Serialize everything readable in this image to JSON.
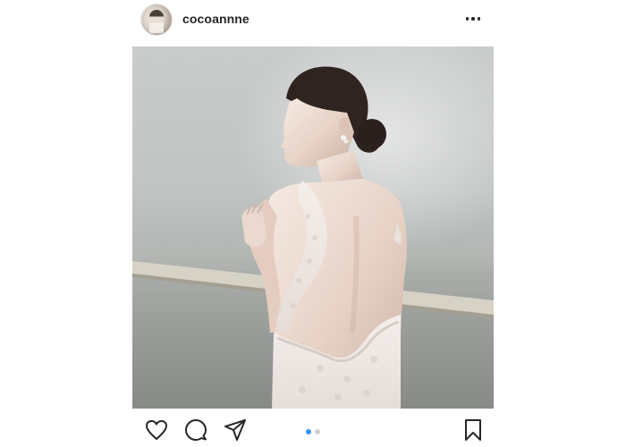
{
  "post": {
    "username": "cocoannne",
    "more_icon": "more-horizontal-icon",
    "avatar_icon": "profile-avatar"
  },
  "media": {
    "description_icon": "bride-photo",
    "carousel": {
      "total": 2,
      "active_index": 0
    }
  },
  "actions": {
    "like_icon": "heart-icon",
    "comment_icon": "comment-icon",
    "share_icon": "paper-plane-icon",
    "save_icon": "bookmark-icon"
  },
  "colors": {
    "text": "#262626",
    "carousel_active": "#3897f0",
    "carousel_inactive": "#cfcfcf"
  }
}
